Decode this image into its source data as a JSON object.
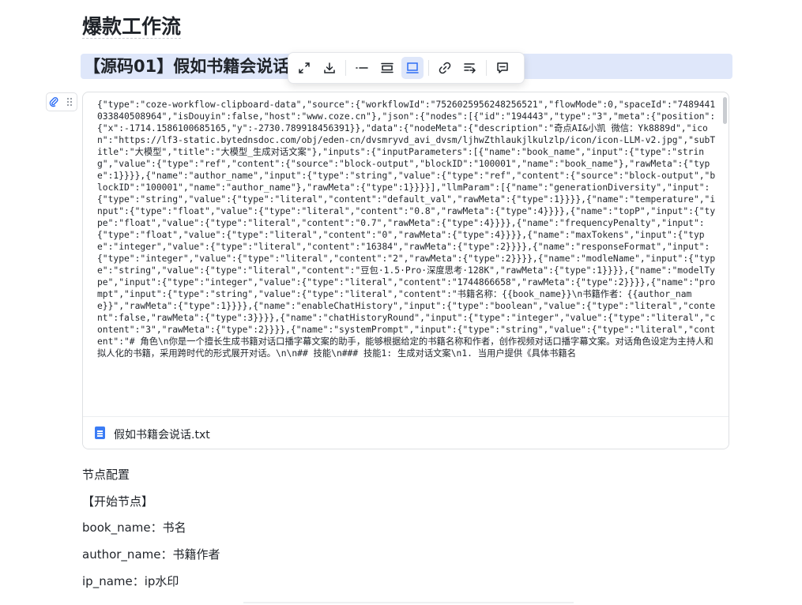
{
  "doc": {
    "title": "爆款工作流",
    "section_heading": "【源码01】假如书籍会说话"
  },
  "toolbar": {
    "buttons": [
      {
        "icon": "expand-icon"
      },
      {
        "icon": "download-icon"
      },
      {
        "icon": "collapse-line-icon"
      },
      {
        "icon": "block-view-icon"
      },
      {
        "icon": "card-view-icon",
        "active": true
      },
      {
        "icon": "link-icon"
      },
      {
        "icon": "convert-icon"
      },
      {
        "icon": "comment-icon"
      }
    ]
  },
  "code_block": {
    "content": "{\"type\":\"coze-workflow-clipboard-data\",\"source\":{\"workflowId\":\"7526025956248256521\",\"flowMode\":0,\"spaceId\":\"7489441033840508964\",\"isDouyin\":false,\"host\":\"www.coze.cn\"},\"json\":{\"nodes\":[{\"id\":\"194443\",\"type\":\"3\",\"meta\":{\"position\":{\"x\":-1714.1586100685165,\"y\":-2730.789918456391}},\"data\":{\"nodeMeta\":{\"description\":\"奇点AI&小凯 微信：Yk8889d\",\"icon\":\"https://lf3-static.bytednsdoc.com/obj/eden-cn/dvsmryvd_avi_dvsm/ljhwZthlaukjlkulzlp/icon/icon-LLM-v2.jpg\",\"subTitle\":\"大模型\",\"title\":\"大模型_生成对话文案\"},\"inputs\":{\"inputParameters\":[{\"name\":\"book_name\",\"input\":{\"type\":\"string\",\"value\":{\"type\":\"ref\",\"content\":{\"source\":\"block-output\",\"blockID\":\"100001\",\"name\":\"book_name\"},\"rawMeta\":{\"type\":1}}}},{\"name\":\"author_name\",\"input\":{\"type\":\"string\",\"value\":{\"type\":\"ref\",\"content\":{\"source\":\"block-output\",\"blockID\":\"100001\",\"name\":\"author_name\"},\"rawMeta\":{\"type\":1}}}}],\"llmParam\":[{\"name\":\"generationDiversity\",\"input\":{\"type\":\"string\",\"value\":{\"type\":\"literal\",\"content\":\"default_val\",\"rawMeta\":{\"type\":1}}}},{\"name\":\"temperature\",\"input\":{\"type\":\"float\",\"value\":{\"type\":\"literal\",\"content\":\"0.8\",\"rawMeta\":{\"type\":4}}}},{\"name\":\"topP\",\"input\":{\"type\":\"float\",\"value\":{\"type\":\"literal\",\"content\":\"0.7\",\"rawMeta\":{\"type\":4}}}},{\"name\":\"frequencyPenalty\",\"input\":{\"type\":\"float\",\"value\":{\"type\":\"literal\",\"content\":\"0\",\"rawMeta\":{\"type\":4}}}},{\"name\":\"maxTokens\",\"input\":{\"type\":\"integer\",\"value\":{\"type\":\"literal\",\"content\":\"16384\",\"rawMeta\":{\"type\":2}}}},{\"name\":\"responseFormat\",\"input\":{\"type\":\"integer\",\"value\":{\"type\":\"literal\",\"content\":\"2\",\"rawMeta\":{\"type\":2}}}},{\"name\":\"modleName\",\"input\":{\"type\":\"string\",\"value\":{\"type\":\"literal\",\"content\":\"豆包·1.5·Pro·深度思考·128K\",\"rawMeta\":{\"type\":1}}}},{\"name\":\"modelType\",\"input\":{\"type\":\"integer\",\"value\":{\"type\":\"literal\",\"content\":\"1744866658\",\"rawMeta\":{\"type\":2}}}},{\"name\":\"prompt\",\"input\":{\"type\":\"string\",\"value\":{\"type\":\"literal\",\"content\":\"书籍名称：{{book_name}}\\n书籍作者：{{author_name}}\",\"rawMeta\":{\"type\":1}}}},{\"name\":\"enableChatHistory\",\"input\":{\"type\":\"boolean\",\"value\":{\"type\":\"literal\",\"content\":false,\"rawMeta\":{\"type\":3}}}},{\"name\":\"chatHistoryRound\",\"input\":{\"type\":\"integer\",\"value\":{\"type\":\"literal\",\"content\":\"3\",\"rawMeta\":{\"type\":2}}}},{\"name\":\"systemPrompt\",\"input\":{\"type\":\"string\",\"value\":{\"type\":\"literal\",\"content\":\"# 角色\\n你是一个擅长生成书籍对话口播字幕文案的助手，能够根据给定的书籍名称和作者，创作视频对话口播字幕文案。对话角色设定为主持人和拟人化的书籍，采用跨时代的形式展开对话。\\n\\n## 技能\\n### 技能1: 生成对话文案\\n1. 当用户提供《具体书籍名",
    "file_name": "假如书籍会说话.txt"
  },
  "body": {
    "node_config": "节点配置",
    "start_node": "【开始节点】",
    "book_name": "book_name：书名",
    "author_name": "author_name：书籍作者",
    "ip_name": "ip_name：ip水印"
  }
}
